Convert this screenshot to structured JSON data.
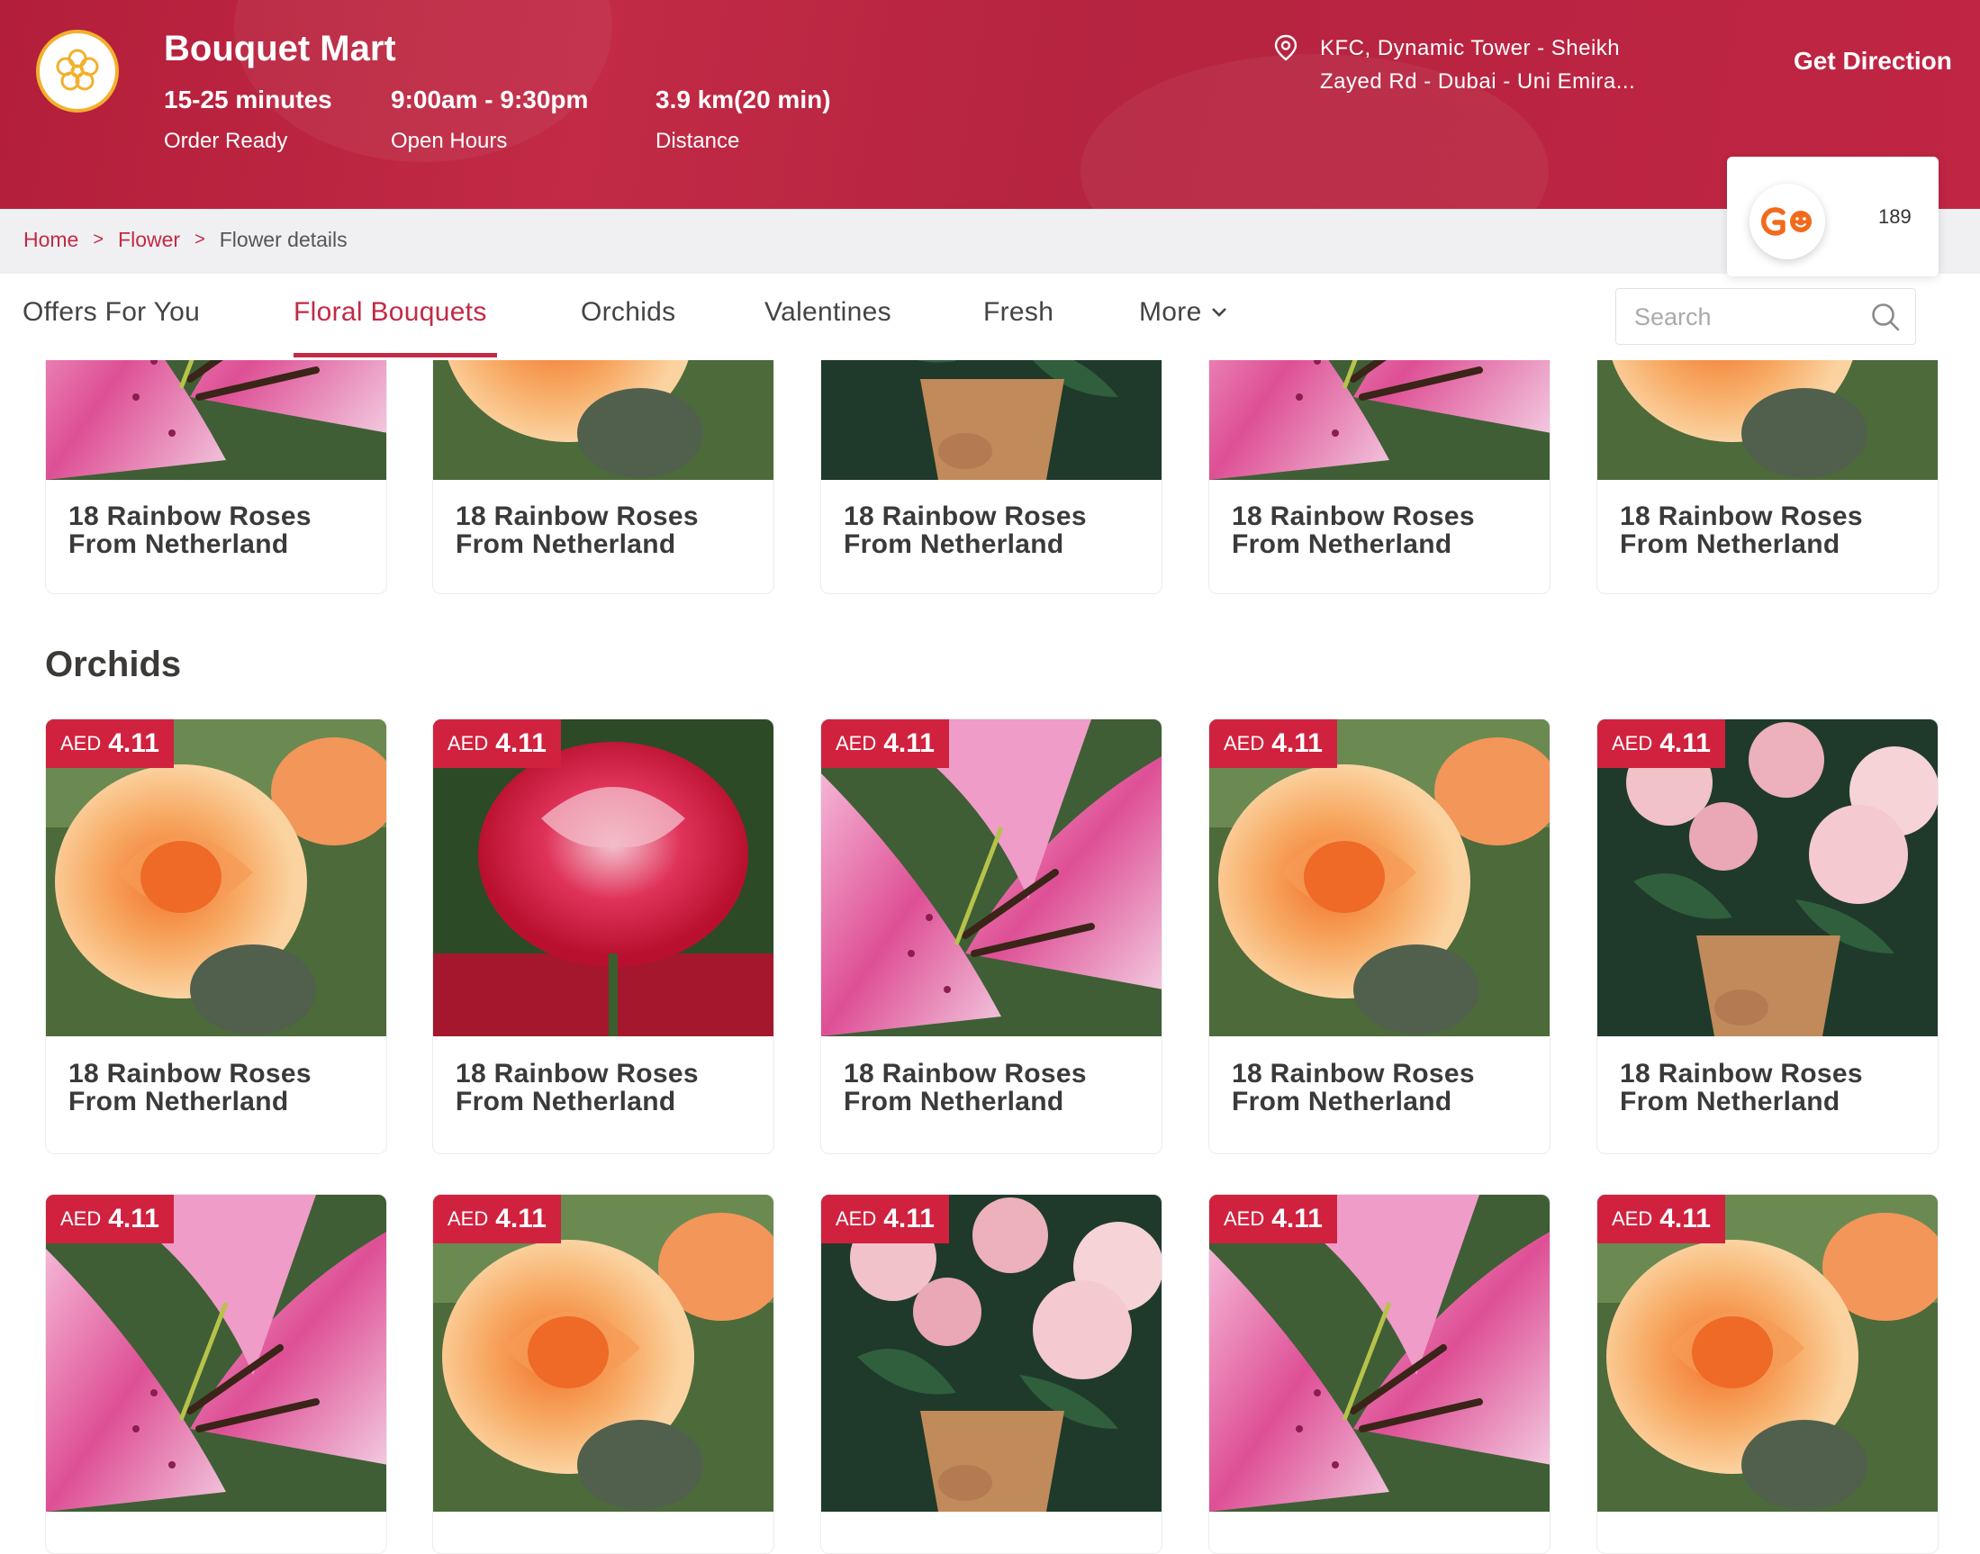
{
  "store": {
    "name": "Bouquet Mart",
    "stats": [
      {
        "value": "15-25 minutes",
        "label": "Order Ready"
      },
      {
        "value": "9:00am - 9:30pm",
        "label": "Open Hours"
      },
      {
        "value": "3.9 km(20 min)",
        "label": "Distance"
      }
    ],
    "address_line1": "KFC, Dynamic Tower - Sheikh",
    "address_line2": "Zayed Rd - Dubai - Uni Emira...",
    "direction_label": "Get Direction"
  },
  "breadcrumb": {
    "items": [
      "Home",
      "Flower",
      "Flower details"
    ],
    "separator": ">"
  },
  "go_badge": {
    "count": "189",
    "logo_text": "GO"
  },
  "nav": {
    "tabs": [
      "Offers For You",
      "Floral Bouquets",
      "Orchids",
      "Valentines",
      "Fresh",
      "More"
    ],
    "active_tab": "Floral Bouquets",
    "search_placeholder": "Search"
  },
  "sections": {
    "top_row": {
      "products": [
        {
          "title_l1": "18 Rainbow Roses",
          "title_l2": "From Netherland",
          "image": "lily"
        },
        {
          "title_l1": "18 Rainbow Roses",
          "title_l2": "From Netherland",
          "image": "orange-rose"
        },
        {
          "title_l1": "18 Rainbow Roses",
          "title_l2": "From Netherland",
          "image": "peony-bouquet"
        },
        {
          "title_l1": "18 Rainbow Roses",
          "title_l2": "From Netherland",
          "image": "lily"
        },
        {
          "title_l1": "18 Rainbow Roses",
          "title_l2": "From Netherland",
          "image": "orange-rose"
        }
      ]
    },
    "orchids": {
      "title": "Orchids",
      "row1": [
        {
          "currency": "AED",
          "price": "4.11",
          "title_l1": "18 Rainbow Roses",
          "title_l2": "From Netherland",
          "image": "orange-rose"
        },
        {
          "currency": "AED",
          "price": "4.11",
          "title_l1": "18 Rainbow Roses",
          "title_l2": "From Netherland",
          "image": "red-rose"
        },
        {
          "currency": "AED",
          "price": "4.11",
          "title_l1": "18 Rainbow Roses",
          "title_l2": "From Netherland",
          "image": "lily"
        },
        {
          "currency": "AED",
          "price": "4.11",
          "title_l1": "18 Rainbow Roses",
          "title_l2": "From Netherland",
          "image": "orange-rose"
        },
        {
          "currency": "AED",
          "price": "4.11",
          "title_l1": "18 Rainbow Roses",
          "title_l2": "From Netherland",
          "image": "peony-bouquet"
        }
      ],
      "row2": [
        {
          "currency": "AED",
          "price": "4.11",
          "image": "lily"
        },
        {
          "currency": "AED",
          "price": "4.11",
          "image": "orange-rose"
        },
        {
          "currency": "AED",
          "price": "4.11",
          "image": "peony-bouquet"
        },
        {
          "currency": "AED",
          "price": "4.11",
          "image": "lily"
        },
        {
          "currency": "AED",
          "price": "4.11",
          "image": "orange-rose"
        }
      ]
    }
  },
  "colors": {
    "brand": "#c22a45",
    "price_tag": "#d0223f",
    "logo_ring": "#f2b02d",
    "go_orange": "#f26b1d"
  }
}
